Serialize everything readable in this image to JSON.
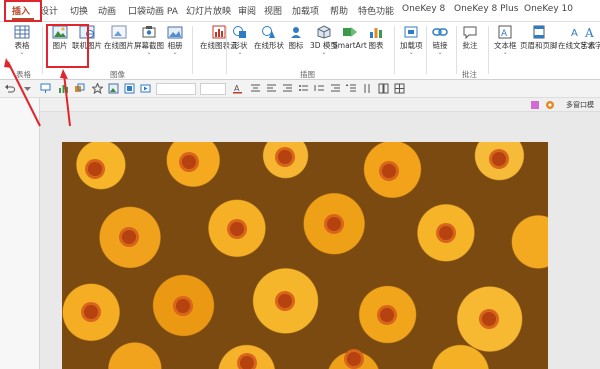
{
  "tabs": [
    {
      "label": "插入",
      "active": true
    },
    {
      "label": "设计"
    },
    {
      "label": "切换"
    },
    {
      "label": "动画"
    },
    {
      "label": "口袋动画 PA"
    },
    {
      "label": "幻灯片放映"
    },
    {
      "label": "审阅"
    },
    {
      "label": "视图"
    },
    {
      "label": "加载项"
    },
    {
      "label": "帮助"
    },
    {
      "label": "特色功能"
    },
    {
      "label": "OneKey 8"
    },
    {
      "label": "OneKey 8 Plus"
    },
    {
      "label": "OneKey 10"
    }
  ],
  "ribbon": {
    "table": "表格",
    "picture": "图片",
    "online_picture": "联机图片",
    "online_picture2": "在线图片",
    "screenshot": "屏幕截图",
    "album": "相册",
    "online_chart_cloud": "在线图表云",
    "shapes": "形状",
    "online_shapes": "在线形状",
    "icons": "图标",
    "models_3d": "3D 模型",
    "smartart": "SmartArt",
    "chart": "图表",
    "addins": "加载项",
    "link": "链接",
    "comment": "批注",
    "textbox": "文本框",
    "header_footer": "页眉和页脚",
    "online_text": "在线文字云",
    "wordart": "艺术字"
  },
  "groups": {
    "tables": "表格",
    "images": "图像",
    "illustrations": "插图",
    "comments": "批注"
  },
  "toolbar": {
    "multi_window": "多窗口模"
  },
  "colors": {
    "accent": "#b7472a",
    "annotation": "#e0262c"
  }
}
